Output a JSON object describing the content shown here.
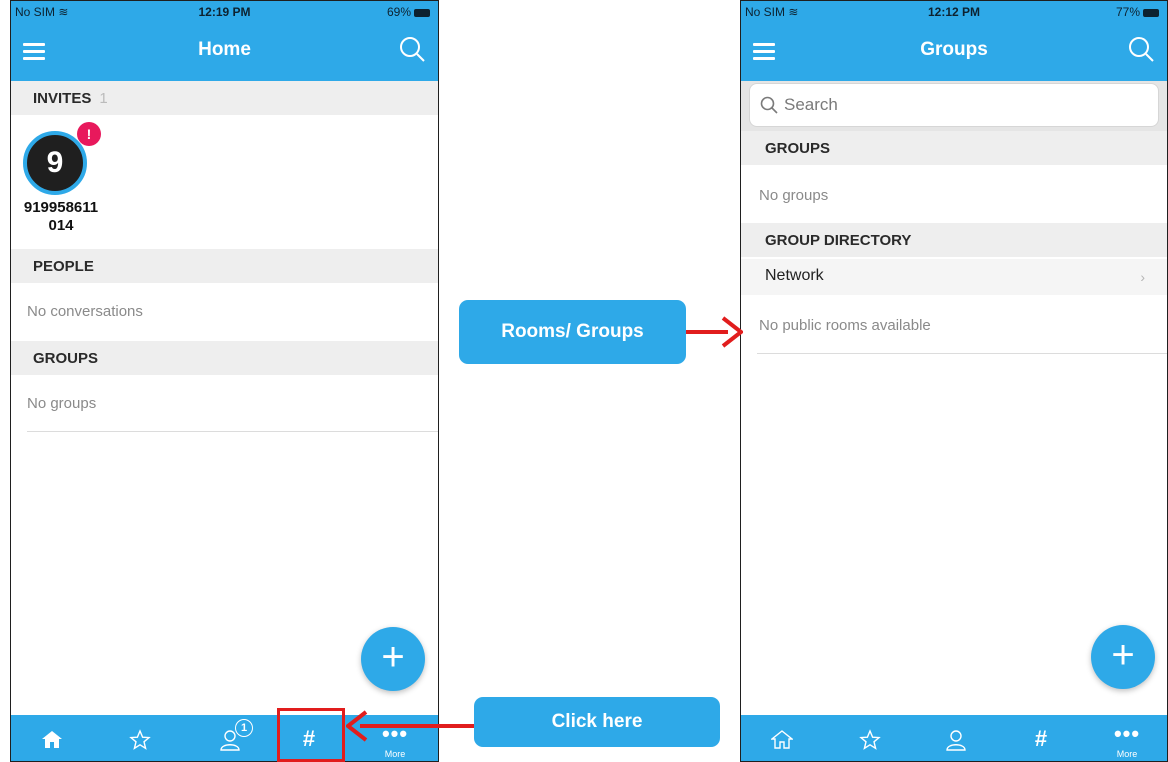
{
  "left": {
    "status": {
      "carrier": "No SIM",
      "time": "12:19 PM",
      "battery": "69%"
    },
    "nav_title": "Home",
    "invites": {
      "label": "INVITES",
      "count": "1",
      "avatar_letter": "9",
      "badge": "!",
      "name_line1": "919958611",
      "name_line2": "014"
    },
    "people": {
      "label": "PEOPLE",
      "empty": "No conversations"
    },
    "groups": {
      "label": "GROUPS",
      "empty": "No groups"
    },
    "fab": "+",
    "tabbar": {
      "people_badge": "1",
      "rooms_glyph": "#",
      "more_label": "More",
      "more_dots": "•••"
    }
  },
  "right": {
    "status": {
      "carrier": "No SIM",
      "time": "12:12 PM",
      "battery": "77%"
    },
    "nav_title": "Groups",
    "search_placeholder": "Search",
    "groups": {
      "label": "GROUPS",
      "empty": "No groups"
    },
    "directory": {
      "label": "GROUP DIRECTORY",
      "network": "Network",
      "empty": "No public rooms available"
    },
    "fab": "+",
    "tabbar": {
      "rooms_glyph": "#",
      "more_label": "More",
      "more_dots": "•••"
    }
  },
  "annotations": {
    "rooms_groups": "Rooms/ Groups",
    "click_here": "Click here"
  },
  "colors": {
    "accent": "#2ea9e8",
    "arrow": "#e11d1d",
    "badge": "#e8195c"
  }
}
